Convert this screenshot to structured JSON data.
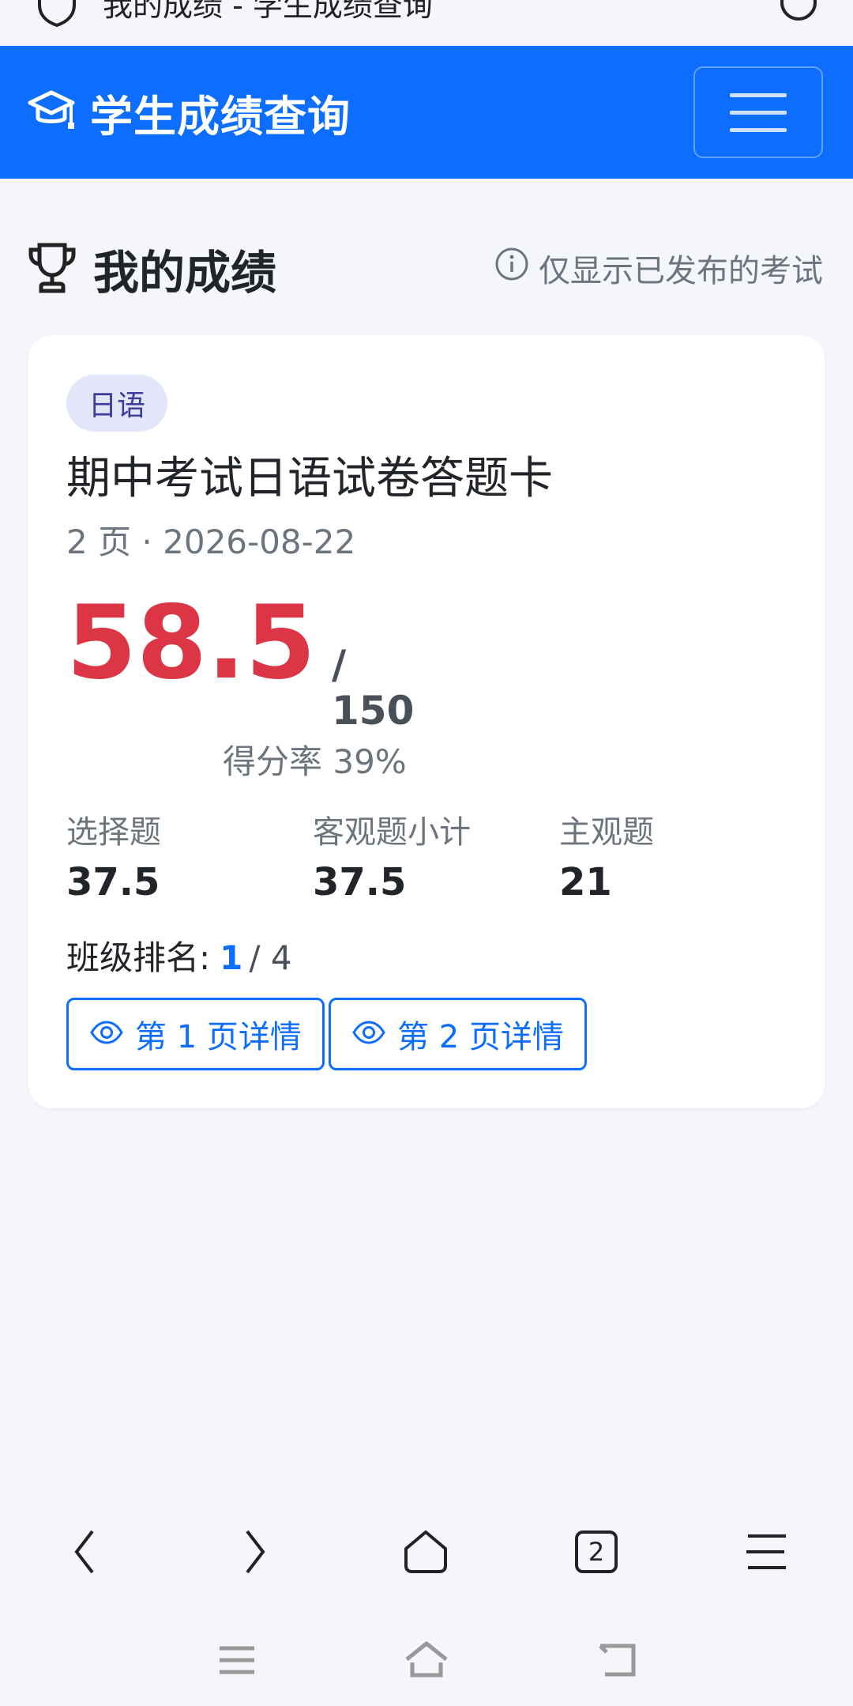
{
  "browser": {
    "title_fragment": "我的成绩 - 学生成绩查询",
    "tab_count": "2"
  },
  "navbar": {
    "brand": "学生成绩查询",
    "bg_color": "#0d6efd"
  },
  "page": {
    "heading": "我的成绩",
    "note": "仅显示已发布的考试"
  },
  "exam": {
    "subject_badge": "日语",
    "title": "期中考试日语试卷答题卡",
    "meta": "2 页 · 2026-08-22",
    "score": "58.5",
    "total": "/ 150",
    "rate": "得分率 39%",
    "stats": [
      {
        "label": "选择题",
        "value": "37.5"
      },
      {
        "label": "客观题小计",
        "value": "37.5"
      },
      {
        "label": "主观题",
        "value": "21"
      }
    ],
    "rank_label": "班级排名:",
    "rank_value": "1",
    "rank_total": "/ 4",
    "buttons": [
      {
        "label": "第 1 页详情"
      },
      {
        "label": "第 2 页详情"
      }
    ],
    "score_color": "#dc3545"
  }
}
